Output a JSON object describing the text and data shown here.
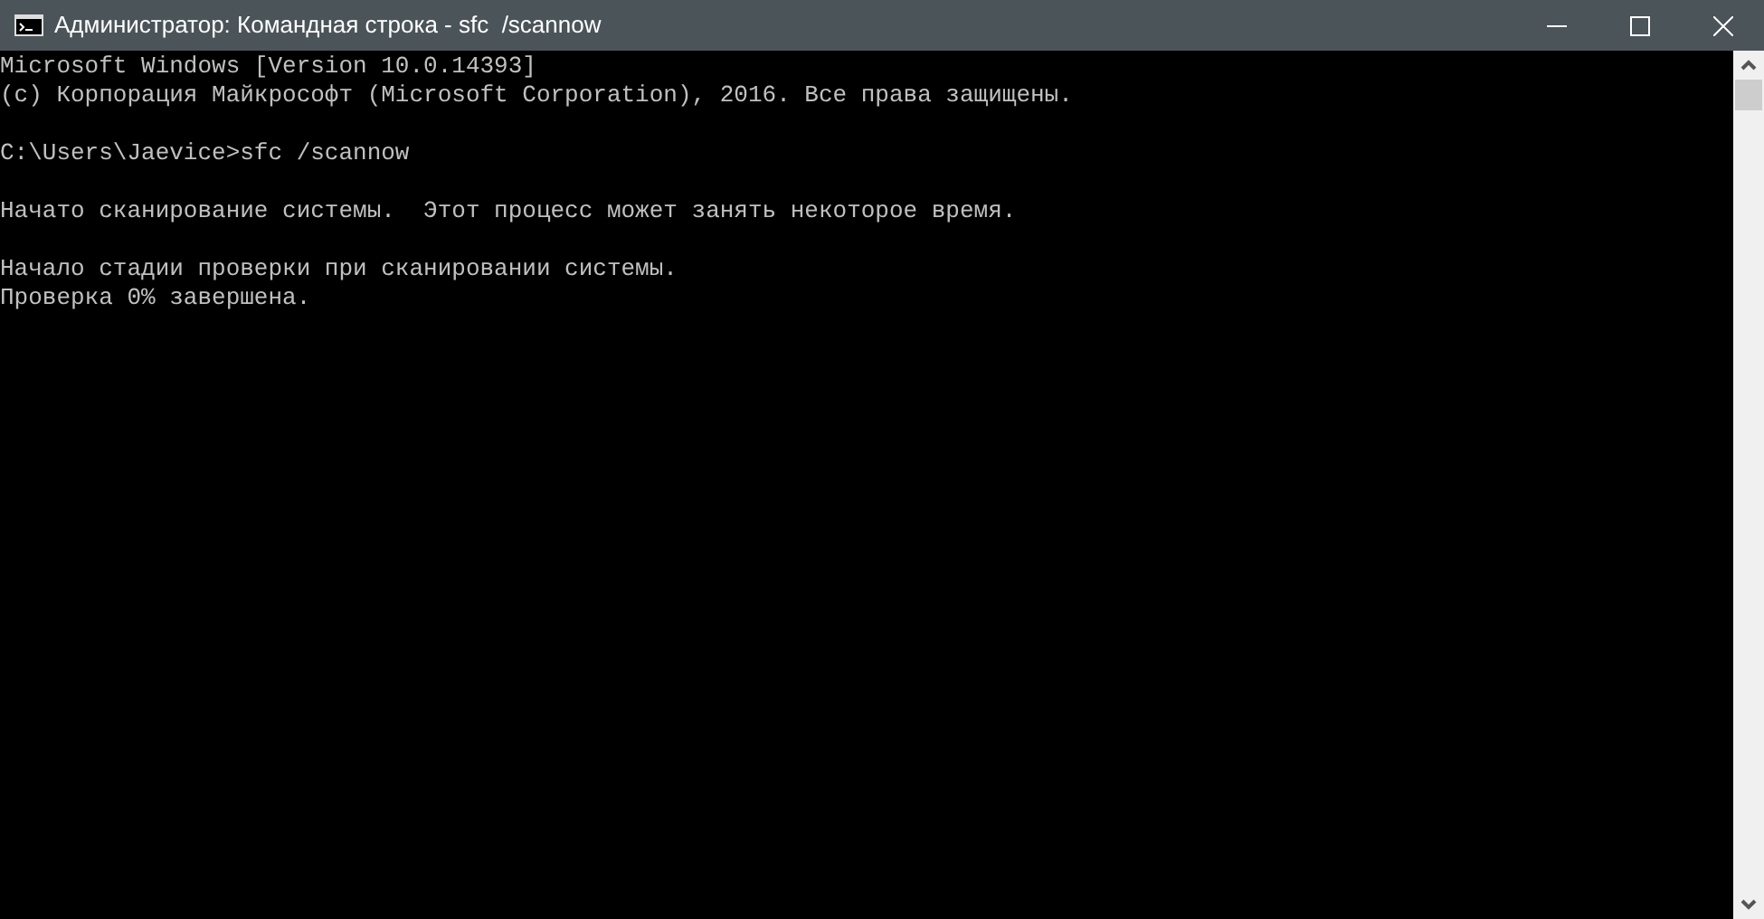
{
  "window": {
    "title": "Администратор: Командная строка - sfc  /scannow"
  },
  "console": {
    "blocks": [
      [
        "Microsoft Windows [Version 10.0.14393]",
        "(c) Корпорация Майкрософт (Microsoft Corporation), 2016. Все права защищены."
      ],
      [
        "C:\\Users\\Jaevice>sfc /scannow"
      ],
      [
        "Начато сканирование системы.  Этот процесс может занять некоторое время."
      ],
      [
        "Начало стадии проверки при сканировании системы.",
        "Проверка 0% завершена."
      ]
    ]
  }
}
